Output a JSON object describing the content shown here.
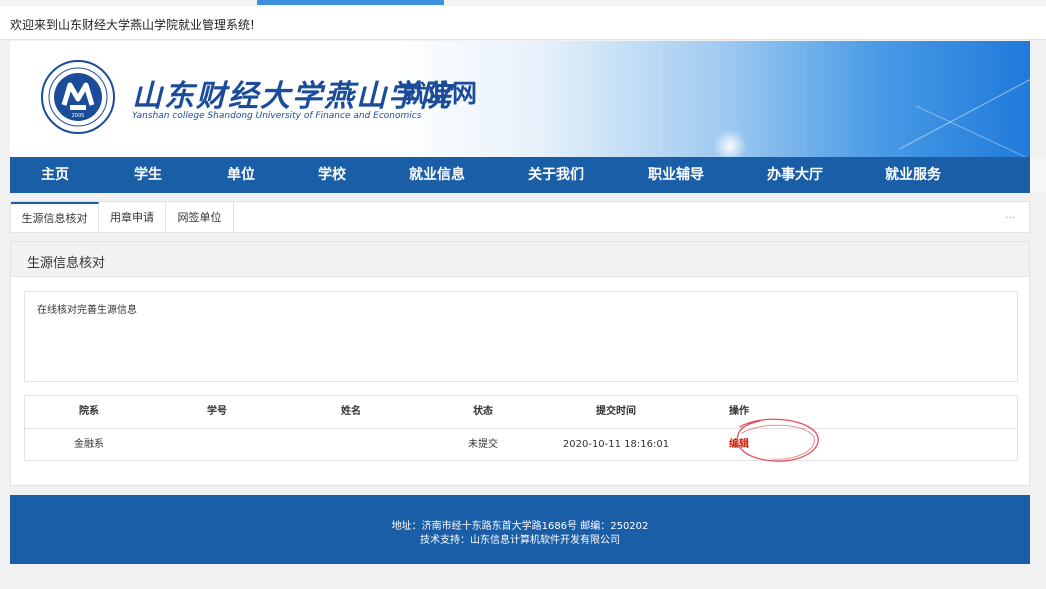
{
  "welcome": "欢迎来到山东财经大学燕山学院就业管理系统!",
  "banner": {
    "title_cn": "山东财经大学燕山学院",
    "title_sub": "就业网",
    "title_en": "Yanshan college Shandong University of Finance and Economics",
    "logo_year": "2005"
  },
  "nav": [
    "主页",
    "学生",
    "单位",
    "学校",
    "就业信息",
    "关于我们",
    "职业辅导",
    "办事大厅",
    "就业服务"
  ],
  "tabs": [
    {
      "label": "生源信息核对",
      "active": true
    },
    {
      "label": "用章申请",
      "active": false
    },
    {
      "label": "网签单位",
      "active": false
    }
  ],
  "tabs_more": "...",
  "panel": {
    "title": "生源信息核对",
    "description": "在线核对完善生源信息"
  },
  "table": {
    "headers": [
      "院系",
      "学号",
      "姓名",
      "状态",
      "提交时间",
      "操作"
    ],
    "rows": [
      {
        "dept": "金融系",
        "student_id": "",
        "name": "",
        "status": "未提交",
        "time": "2020-10-11 18:16:01",
        "action": "编辑"
      }
    ]
  },
  "footer": {
    "line1": "地址：济南市经十东路东首大学路1686号   邮编：250202",
    "line2": "技术支持：山东信息计算机软件开发有限公司"
  },
  "colors": {
    "nav_bg": "#1b5ea8",
    "footer_bg": "#1b5ea8",
    "edit_link": "#d81e06",
    "annotation_circle": "#e0505a"
  }
}
